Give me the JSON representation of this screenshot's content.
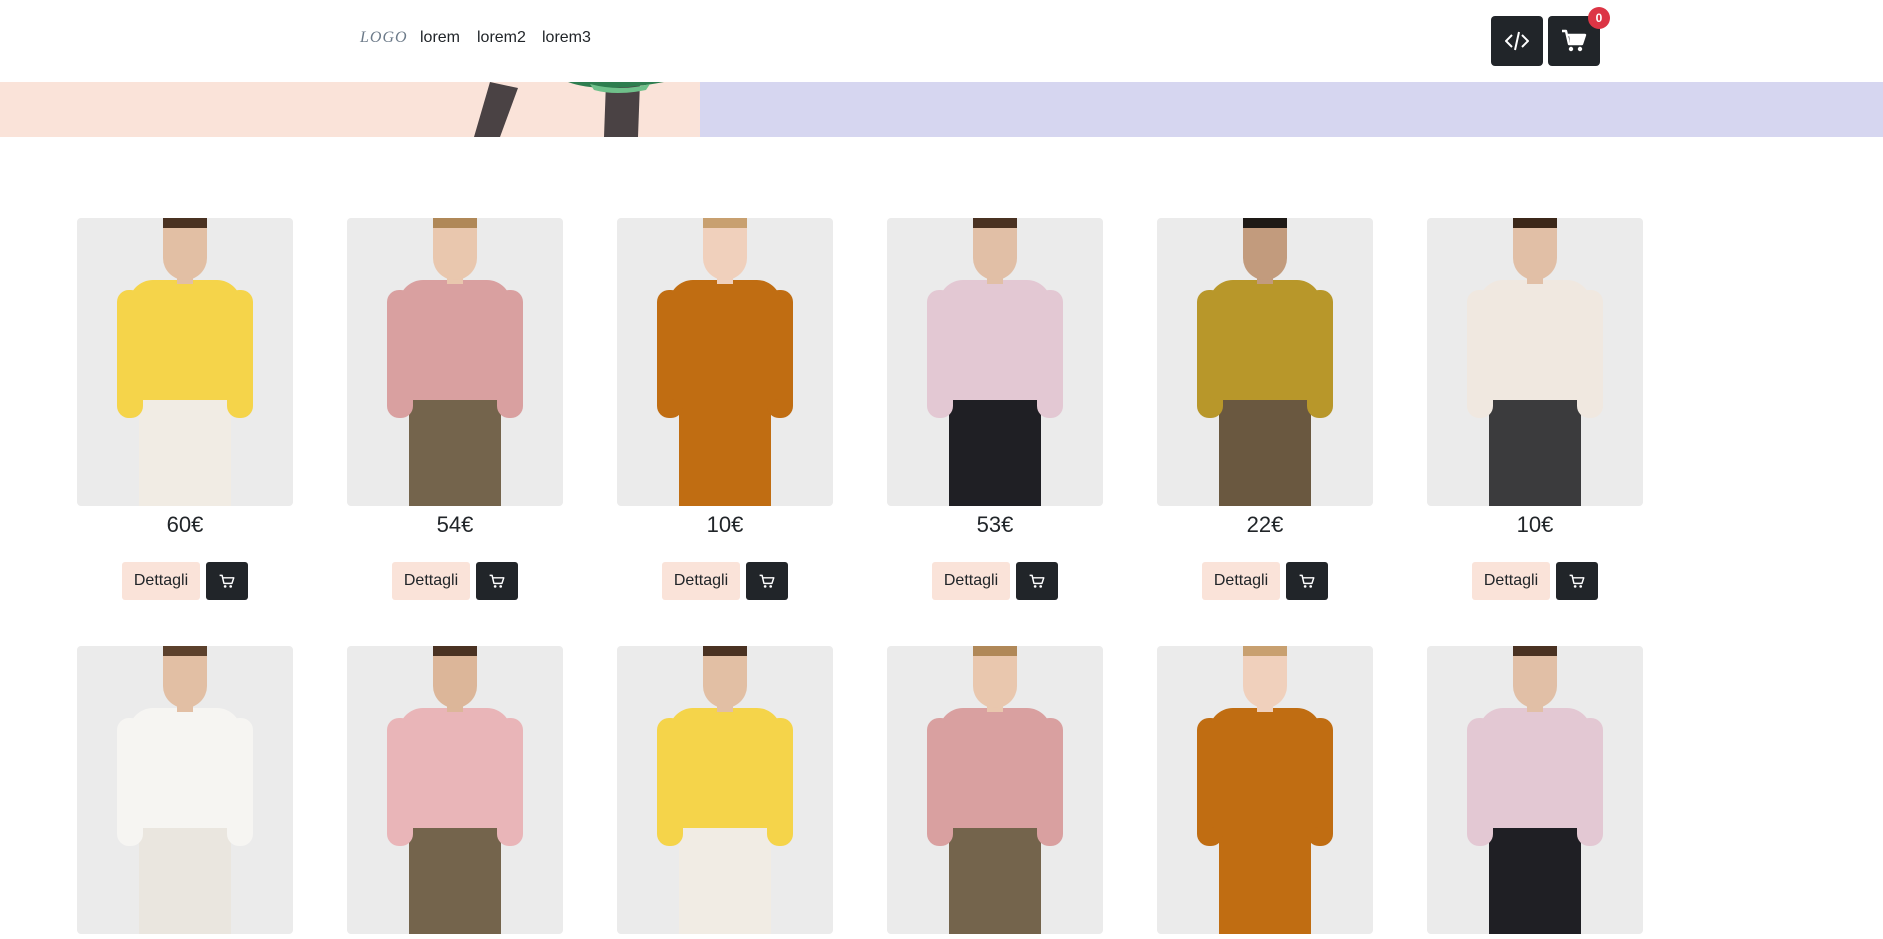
{
  "navbar": {
    "logo": "LOGO",
    "links": [
      "lorem",
      "lorem2",
      "lorem3"
    ],
    "cart_count": "0"
  },
  "product_rows": [
    [
      {
        "price": "60€",
        "details_label": "Dettagli",
        "top": "#f5d44a",
        "bottom": "#f1ece4",
        "skin": "#e2bfa4",
        "hair": "#4a3222"
      },
      {
        "price": "54€",
        "details_label": "Dettagli",
        "top": "#d9a0a0",
        "bottom": "#74644c",
        "skin": "#e9c7ae",
        "hair": "#b08858"
      },
      {
        "price": "10€",
        "details_label": "Dettagli",
        "top": "#c06d12",
        "bottom": "#c06d12",
        "skin": "#f0d0bc",
        "hair": "#c8a070"
      },
      {
        "price": "53€",
        "details_label": "Dettagli",
        "top": "#e3c8d3",
        "bottom": "#1f1f24",
        "skin": "#e1bfa6",
        "hair": "#4a3222"
      },
      {
        "price": "22€",
        "details_label": "Dettagli",
        "top": "#b8972a",
        "bottom": "#6a5840",
        "skin": "#c29b7d",
        "hair": "#1e1a16"
      },
      {
        "price": "10€",
        "details_label": "Dettagli",
        "top": "#f0e8e0",
        "bottom": "#3b3b3d",
        "skin": "#e1bfa6",
        "hair": "#3c281a"
      }
    ],
    [
      {
        "top": "#f6f5f2",
        "bottom": "#eae6df",
        "skin": "#e2bfa4",
        "hair": "#5c412c"
      },
      {
        "top": "#e9b5b8",
        "bottom": "#74644c",
        "skin": "#dcb699",
        "hair": "#4a3222"
      },
      {
        "top": "#f5d44a",
        "bottom": "#f1ece4",
        "skin": "#e2bfa4",
        "hair": "#4a3222"
      },
      {
        "top": "#d9a0a0",
        "bottom": "#74644c",
        "skin": "#e9c7ae",
        "hair": "#b08858"
      },
      {
        "top": "#c06d12",
        "bottom": "#c06d12",
        "skin": "#f0d0bc",
        "hair": "#c8a070"
      },
      {
        "top": "#e3c8d3",
        "bottom": "#1f1f24",
        "skin": "#e1bfa6",
        "hair": "#4a3222"
      }
    ]
  ]
}
